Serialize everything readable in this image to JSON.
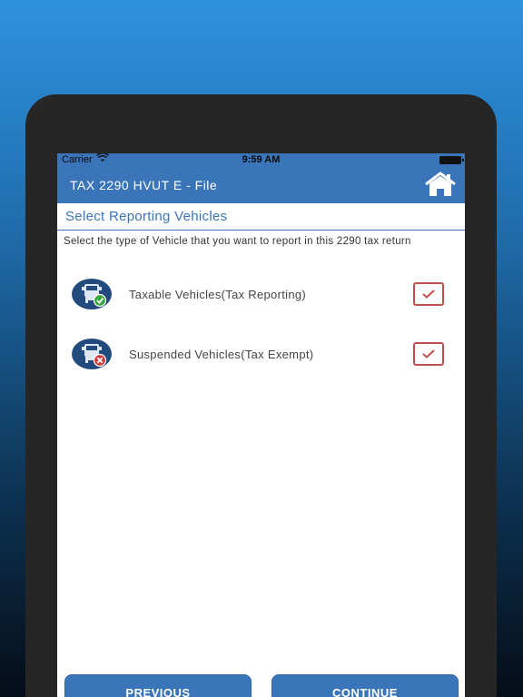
{
  "status_bar": {
    "carrier": "Carrier",
    "time": "9:59 AM"
  },
  "nav": {
    "title": "TAX 2290 HVUT E - File",
    "home_icon": "home-icon"
  },
  "section": {
    "title": "Select Reporting Vehicles",
    "instruction": "Select the type of Vehicle that you want to report in this 2290 tax return"
  },
  "vehicles": [
    {
      "label": "Taxable Vehicles(Tax Reporting)",
      "icon": "truck-check-icon",
      "checked": true
    },
    {
      "label": "Suspended Vehicles(Tax Exempt)",
      "icon": "truck-x-icon",
      "checked": true
    }
  ],
  "footer": {
    "previous_label": "PREVIOUS",
    "continue_label": "CONTINUE"
  },
  "colors": {
    "primary": "#3a74b9",
    "checkbox": "#c0504d",
    "icon_bg": "#234a7d"
  }
}
